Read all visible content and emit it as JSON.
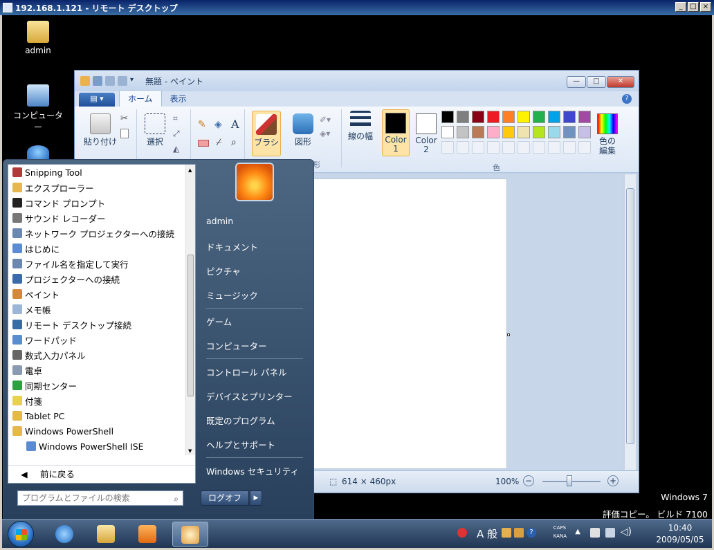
{
  "rdp": {
    "title": "192.168.1.121 - リモート デスクトップ"
  },
  "desktop": {
    "icons": [
      {
        "label": "admin"
      },
      {
        "label": "コンピューター"
      }
    ]
  },
  "paint": {
    "title": "無題 - ペイント",
    "tabs": {
      "file": "▤ ▾",
      "home": "ホーム",
      "view": "表示"
    },
    "ribbon": {
      "paste": "貼り付け",
      "select": "選択",
      "brush": "ブラシ",
      "shapes": "図形",
      "shapes_group_partial": "形",
      "line_width": "線の幅",
      "color1": "Color 1",
      "color2": "Color 2",
      "edit_colors": "色の\n編集",
      "colors_group": "色"
    },
    "palette_row1": [
      "#000000",
      "#7f7f7f",
      "#880015",
      "#ed1c24",
      "#ff7f27",
      "#fff200",
      "#22b14c",
      "#00a2e8",
      "#3f48cc",
      "#a349a4"
    ],
    "palette_row2": [
      "#ffffff",
      "#c3c3c3",
      "#b97a57",
      "#ffaec9",
      "#ffc90e",
      "#efe4b0",
      "#b5e61d",
      "#99d9ea",
      "#7092be",
      "#c8bfe7"
    ],
    "status": {
      "size": "614 × 460px",
      "zoom": "100%"
    }
  },
  "start_menu": {
    "programs": [
      {
        "label": "Snipping Tool",
        "color": "#b33a3a"
      },
      {
        "label": "エクスプローラー",
        "color": "#e5b84b"
      },
      {
        "label": "コマンド プロンプト",
        "color": "#222222"
      },
      {
        "label": "サウンド レコーダー",
        "color": "#777777"
      },
      {
        "label": "ネットワーク プロジェクターへの接続",
        "color": "#6a88b0"
      },
      {
        "label": "はじめに",
        "color": "#5b8bd0"
      },
      {
        "label": "ファイル名を指定して実行",
        "color": "#6a88b0"
      },
      {
        "label": "プロジェクターへの接続",
        "color": "#3a6aa8"
      },
      {
        "label": "ペイント",
        "color": "#d28a3a"
      },
      {
        "label": "メモ帳",
        "color": "#9bb6d6"
      },
      {
        "label": "リモート デスクトップ接続",
        "color": "#3a6aa8"
      },
      {
        "label": "ワードパッド",
        "color": "#5b8bd0"
      },
      {
        "label": "数式入力パネル",
        "color": "#666666"
      },
      {
        "label": "電卓",
        "color": "#8a9ab0"
      },
      {
        "label": "同期センター",
        "color": "#2fa040"
      },
      {
        "label": "付箋",
        "color": "#e8d050"
      },
      {
        "label": "Tablet PC",
        "color": "#e5b84b"
      },
      {
        "label": "Windows PowerShell",
        "color": "#e5b84b"
      },
      {
        "label": "Windows PowerShell ISE",
        "color": "#5b8bd0",
        "indent": true
      }
    ],
    "back": "前に戻る",
    "search_placeholder": "プログラムとファイルの検索",
    "right": {
      "user": "admin",
      "documents": "ドキュメント",
      "pictures": "ピクチャ",
      "music": "ミュージック",
      "games": "ゲーム",
      "computer": "コンピューター",
      "control_panel": "コントロール パネル",
      "devices": "デバイスとプリンター",
      "default_programs": "既定のプログラム",
      "help": "ヘルプとサポート",
      "security": "Windows セキュリティ"
    },
    "logoff": "ログオフ"
  },
  "watermark": {
    "line1": "Windows 7",
    "line2": "評価コピー。 ビルド 7100"
  },
  "taskbar": {
    "tray_caps": "CAPS",
    "tray_kana": "KANA",
    "ime_mode": "A 般",
    "time": "10:40",
    "date": "2009/05/05"
  }
}
